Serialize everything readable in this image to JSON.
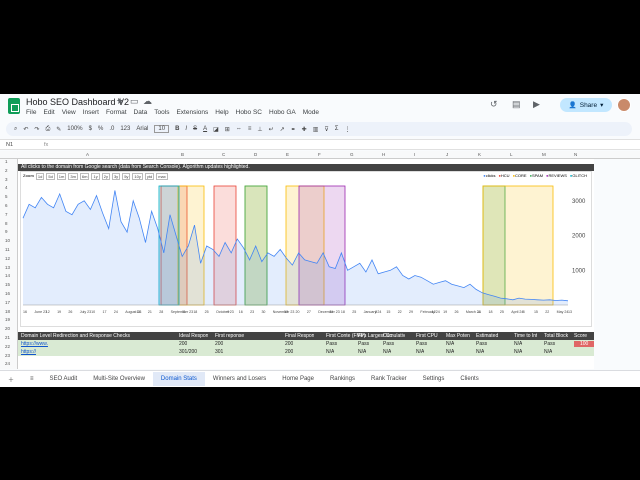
{
  "app": {
    "title": "Hobo SEO Dashboard V2",
    "menus": [
      "File",
      "Edit",
      "View",
      "Insert",
      "Format",
      "Data",
      "Tools",
      "Extensions",
      "Help",
      "Hobo SC",
      "Hobo GA",
      "Mode"
    ],
    "share": "Share"
  },
  "toolbar": {
    "zoom": "100%",
    "currency": "$",
    "percent": "%",
    "decimals": ".0",
    ".00": ".00",
    "format": "123",
    "font": "Arial",
    "fontsize": "10",
    "bold": "B",
    "italic": "I",
    "strike": "S",
    "textcolor": "A"
  },
  "formula_bar": {
    "cell": "N1",
    "fx": "fx"
  },
  "columns": [
    "A",
    "B",
    "C",
    "D",
    "E",
    "F",
    "G",
    "H",
    "I",
    "J",
    "K",
    "L",
    "M",
    "N"
  ],
  "rows": [
    "1",
    "2",
    "3",
    "4",
    "5",
    "6",
    "7",
    "8",
    "9",
    "10",
    "11",
    "12",
    "13",
    "14",
    "15",
    "16",
    "17",
    "18",
    "19",
    "20",
    "21",
    "22",
    "23",
    "24"
  ],
  "banner": "All clicks to the domain from Google search (data from Search Console). Algorithm updates highlighted.",
  "zoom_label": "Zoom",
  "zoom_buttons": [
    "1d",
    "5d",
    "1m",
    "3m",
    "6m",
    "1y",
    "2y",
    "3y",
    "5y",
    "10y",
    "ytd",
    "max"
  ],
  "legend": [
    {
      "name": "clicks",
      "color": "#4285f4"
    },
    {
      "name": "HCU",
      "color": "#ea4335"
    },
    {
      "name": "CORE",
      "color": "#fbbc04"
    },
    {
      "name": "SPAM",
      "color": "#34a853"
    },
    {
      "name": "REVIEWS",
      "color": "#9c27b0"
    },
    {
      "name": "GLITCH",
      "color": "#00acc1"
    }
  ],
  "chart_data": {
    "type": "area",
    "y_ticks": [
      "1000",
      "2000",
      "3000"
    ],
    "x_labels": [
      "16",
      "June 23",
      "12",
      "19",
      "26",
      "July 23",
      "10",
      "17",
      "24",
      "August 23",
      "14",
      "21",
      "28",
      "September 23",
      "11",
      "18",
      "25",
      "October 23",
      "9",
      "16",
      "23",
      "30",
      "November 23",
      "13",
      "20",
      "27",
      "December 23",
      "11",
      "18",
      "25",
      "January 24",
      "8",
      "15",
      "22",
      "29",
      "February 24",
      "12",
      "19",
      "26",
      "March 24",
      "11",
      "18",
      "25",
      "April 24",
      "8",
      "15",
      "22",
      "May 24",
      "13"
    ],
    "clicks": [
      2500,
      2900,
      2800,
      3100,
      2900,
      2800,
      3200,
      2700,
      2600,
      2900,
      3000,
      2750,
      3150,
      2650,
      2200,
      3300,
      2400,
      2100,
      3000,
      2500,
      1800,
      2700,
      2200,
      1500,
      2600,
      2000,
      1400,
      1700,
      2300,
      1200,
      1700,
      1600,
      1400,
      1800,
      1500,
      1900,
      1650,
      1300,
      1700,
      1250,
      1500,
      1400,
      1600,
      1350,
      1150,
      1500,
      1300,
      1250,
      1200,
      1500,
      1100,
      1050,
      1500,
      1000,
      1100,
      1200,
      950,
      1300,
      900,
      950,
      1000,
      1100,
      850,
      750,
      850,
      800,
      700,
      600,
      650,
      700,
      600,
      550,
      500,
      600,
      450,
      350,
      300,
      250,
      200,
      180,
      150,
      200,
      170,
      160,
      150,
      140,
      150,
      130,
      140,
      120
    ]
  },
  "sheet_rows": [
    [
      "Domain Level Redirection and Response Checks",
      "Ideal Respon",
      "First reponse",
      "Final Respon",
      "First Conte (FMP)",
      "Firs Largest Cc",
      "Cumulativ",
      "First CPU",
      "Max Poten",
      "Estimated",
      "Time to Int",
      "Total Block",
      "Score"
    ],
    [
      "https://www.",
      "200",
      "200",
      "200",
      "Pass",
      "Pass",
      "Pass",
      "Pass",
      "N/A",
      "Pass",
      "N/A",
      "Pass",
      "100"
    ],
    [
      "https://",
      "301/200",
      "301",
      "200",
      "N/A",
      "N/A",
      "N/A",
      "N/A",
      "N/A",
      "N/A",
      "N/A",
      "N/A",
      ""
    ]
  ],
  "tabs": [
    "SEO Audit",
    "Multi-Site Overview",
    "Domain Stats",
    "Winners and Losers",
    "Home Page",
    "Rankings",
    "Rank Tracker",
    "Settings",
    "Clients"
  ]
}
